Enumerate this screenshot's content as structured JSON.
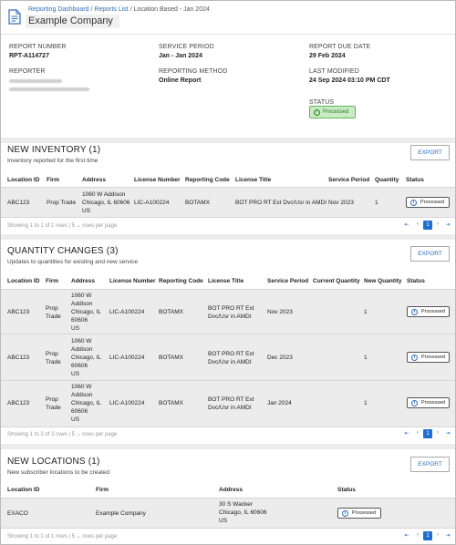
{
  "header": {
    "breadcrumb": {
      "dashboard": "Reporting Dashboard",
      "sep1": " / ",
      "reports": "Reports List",
      "sep2": " / ",
      "current": "Location Based - Jan 2024"
    },
    "company": "Example Company"
  },
  "report": {
    "number_label": "REPORT NUMBER",
    "number": "RPT-A114727",
    "period_label": "SERVICE PERIOD",
    "period": "Jan - Jan 2024",
    "due_label": "REPORT DUE DATE",
    "due": "29 Feb 2024",
    "reporter_label": "REPORTER",
    "method_label": "REPORTING METHOD",
    "method": "Online Report",
    "modified_label": "LAST MODIFIED",
    "modified": "24 Sep 2024 03:10 PM CDT",
    "status_label": "STATUS",
    "status": "Processed"
  },
  "export_label": "EXPORT",
  "new_inventory": {
    "title": "NEW INVENTORY (1)",
    "subtitle": "Inventory reported for the first time",
    "columns": [
      "Location ID",
      "Firm",
      "Address",
      "License Number",
      "Reporting Code",
      "License Title",
      "Service Period",
      "Quantity",
      "Status"
    ],
    "rows": [
      {
        "location_id": "ABC123",
        "firm": "Prop Trade",
        "address": [
          "1060 W Addison",
          "Chicago, IL 60606",
          "US"
        ],
        "license_number": "LIC-A100224",
        "reporting_code": "BOTAMX",
        "license_title": "BOT PRO RT Ext Dvc/Usr in AMDI",
        "service_period": "Nov 2023",
        "quantity": "1",
        "status": "Processed"
      }
    ],
    "pager": "Showing 1 to 1 of 1 rows | 5 ⌄ rows per page",
    "page": "1"
  },
  "quantity_changes": {
    "title": "QUANTITY CHANGES (3)",
    "subtitle": "Updates to quantities for existing and new service",
    "columns": [
      "Location ID",
      "Firm",
      "Address",
      "License Number",
      "Reporting Code",
      "License Title",
      "Service Period",
      "Current Quantity",
      "New Quantity",
      "Status"
    ],
    "rows": [
      {
        "location_id": "ABC123",
        "firm": [
          "Prop",
          "Trade"
        ],
        "address": [
          "1060 W",
          "Addison",
          "Chicago, IL",
          "60606",
          "US"
        ],
        "license_number": "LIC-A100224",
        "reporting_code": "BOTAMX",
        "license_title": [
          "BOT PRO RT Ext",
          "Dvc/Usr in AMDI"
        ],
        "service_period": "Nov 2023",
        "current_quantity": "",
        "new_quantity": "1",
        "status": "Processed"
      },
      {
        "location_id": "ABC123",
        "firm": [
          "Prop",
          "Trade"
        ],
        "address": [
          "1060 W",
          "Addison",
          "Chicago, IL",
          "60606",
          "US"
        ],
        "license_number": "LIC-A100224",
        "reporting_code": "BOTAMX",
        "license_title": [
          "BOT PRO RT Ext",
          "Dvc/Usr in AMDI"
        ],
        "service_period": "Dec 2023",
        "current_quantity": "",
        "new_quantity": "1",
        "status": "Processed"
      },
      {
        "location_id": "ABC123",
        "firm": [
          "Prop",
          "Trade"
        ],
        "address": [
          "1060 W",
          "Addison",
          "Chicago, IL",
          "60606",
          "US"
        ],
        "license_number": "LIC-A100224",
        "reporting_code": "BOTAMX",
        "license_title": [
          "BOT PRO RT Ext",
          "Dvc/Usr in AMDI"
        ],
        "service_period": "Jan 2024",
        "current_quantity": "",
        "new_quantity": "1",
        "status": "Processed"
      }
    ],
    "pager": "Showing 1 to 3 of 3 rows | 5 ⌄ rows per page",
    "page": "1"
  },
  "new_locations": {
    "title": "NEW LOCATIONS (1)",
    "subtitle": "New subscriber locations to be created",
    "columns": [
      "Location ID",
      "Firm",
      "Address",
      "Status"
    ],
    "rows": [
      {
        "location_id": "EXACO",
        "firm": "Example Company",
        "address": [
          "30 S Wacker",
          "Chicago, IL 60606",
          "US"
        ],
        "status": "Processed"
      }
    ],
    "pager": "Showing 1 to 1 of 1 rows | 5 ⌄ rows per page",
    "page": "1"
  },
  "pager_icons": {
    "first": "⇤",
    "prev": "‹",
    "next": "›",
    "last": "⇥"
  },
  "colors": {
    "link": "#2f6fb7",
    "status_green": "#62b35b",
    "page_active": "#1f6fd1"
  }
}
